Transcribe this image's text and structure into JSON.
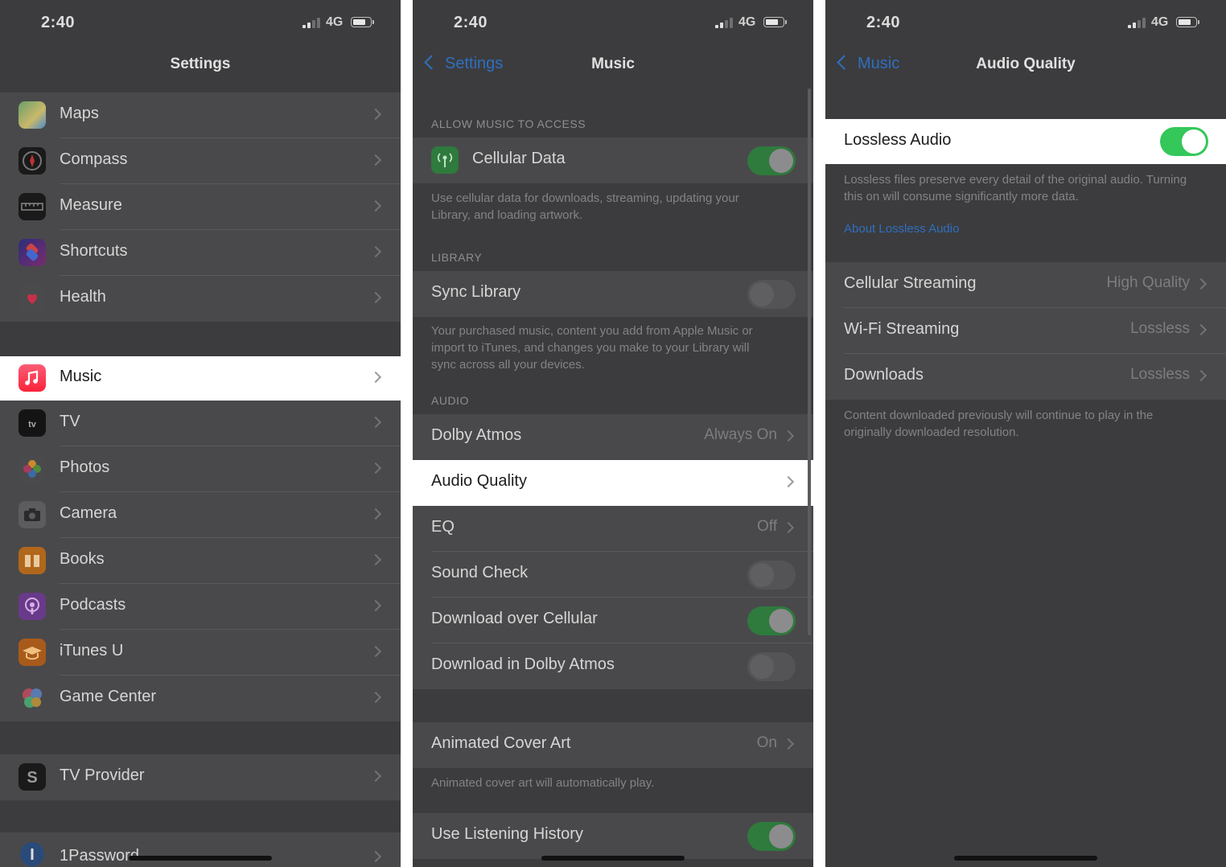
{
  "status": {
    "time": "2:40",
    "network": "4G"
  },
  "p1": {
    "title": "Settings",
    "group1": [
      {
        "label": "Maps",
        "icon": "maps-icon"
      },
      {
        "label": "Compass",
        "icon": "compass-icon"
      },
      {
        "label": "Measure",
        "icon": "measure-icon"
      },
      {
        "label": "Shortcuts",
        "icon": "shortcuts-icon"
      },
      {
        "label": "Health",
        "icon": "health-icon"
      }
    ],
    "group2": [
      {
        "label": "Music",
        "icon": "music-icon"
      },
      {
        "label": "TV",
        "icon": "tv-icon"
      },
      {
        "label": "Photos",
        "icon": "photos-icon"
      },
      {
        "label": "Camera",
        "icon": "camera-icon"
      },
      {
        "label": "Books",
        "icon": "books-icon"
      },
      {
        "label": "Podcasts",
        "icon": "podcasts-icon"
      },
      {
        "label": "iTunes U",
        "icon": "itunes-u-icon"
      },
      {
        "label": "Game Center",
        "icon": "game-center-icon"
      }
    ],
    "group3": [
      {
        "label": "TV Provider",
        "icon": "tv-provider-icon"
      }
    ],
    "group4": [
      {
        "label": "1Password",
        "icon": "onepassword-icon"
      }
    ]
  },
  "p2": {
    "back": "Settings",
    "title": "Music",
    "hdr_access": "ALLOW MUSIC TO ACCESS",
    "cellular_data": "Cellular Data",
    "cellular_foot": "Use cellular data for downloads, streaming, updating your Library, and loading artwork.",
    "hdr_library": "LIBRARY",
    "sync_library": "Sync Library",
    "library_foot": "Your purchased music, content you add from Apple Music or import to iTunes, and changes you make to your Library will sync across all your devices.",
    "hdr_audio": "AUDIO",
    "dolby_atmos": "Dolby Atmos",
    "dolby_atmos_val": "Always On",
    "audio_quality": "Audio Quality",
    "eq": "EQ",
    "eq_val": "Off",
    "sound_check": "Sound Check",
    "download_cellular": "Download over Cellular",
    "download_dolby": "Download in Dolby Atmos",
    "animated_art": "Animated Cover Art",
    "animated_art_val": "On",
    "animated_foot": "Animated cover art will automatically play.",
    "listening_history": "Use Listening History"
  },
  "p3": {
    "back": "Music",
    "title": "Audio Quality",
    "lossless": "Lossless Audio",
    "lossless_foot": "Lossless files preserve every detail of the original audio. Turning this on will consume significantly more data.",
    "about_link": "About Lossless Audio",
    "cell_stream": "Cellular Streaming",
    "cell_stream_val": "High Quality",
    "wifi_stream": "Wi-Fi Streaming",
    "wifi_stream_val": "Lossless",
    "downloads": "Downloads",
    "downloads_val": "Lossless",
    "downloads_foot": "Content downloaded previously will continue to play in the originally downloaded resolution."
  }
}
